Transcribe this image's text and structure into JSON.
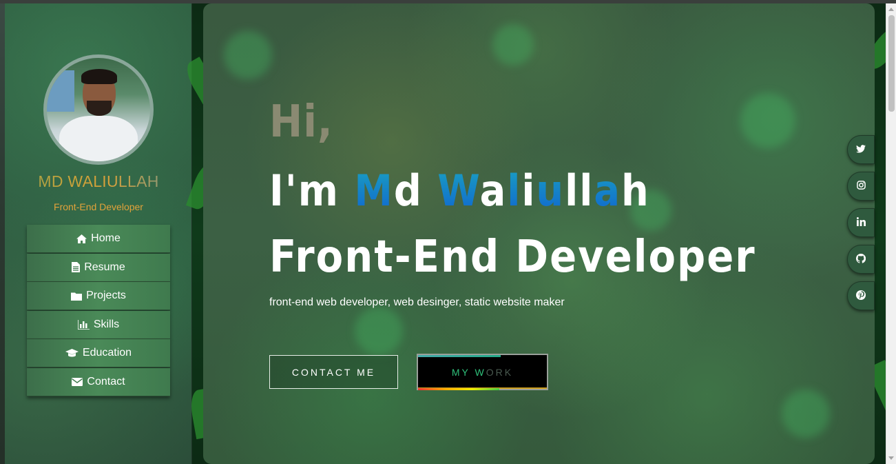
{
  "profile": {
    "name": "MD WALIULLAH",
    "role": "Front-End Developer"
  },
  "nav": {
    "items": [
      {
        "label": "Home",
        "icon": "home-icon"
      },
      {
        "label": "Resume",
        "icon": "file-icon"
      },
      {
        "label": "Projects",
        "icon": "folder-icon"
      },
      {
        "label": "Skills",
        "icon": "bar-chart-icon"
      },
      {
        "label": "Education",
        "icon": "graduation-cap-icon"
      },
      {
        "label": "Contact",
        "icon": "envelope-icon"
      }
    ]
  },
  "hero": {
    "greeting": "Hi,",
    "intro_prefix": "I'm ",
    "name_letters": [
      "M",
      "d",
      " ",
      "W",
      "a",
      "l",
      "i",
      "u",
      "l",
      "l",
      "a",
      "h"
    ],
    "title": "Front-End Developer",
    "tagline": "front-end web developer, web desinger, static website maker",
    "contact_button": "CONTACT ME",
    "work_button_a": "MY W",
    "work_button_b": "ORK"
  },
  "social": {
    "items": [
      "twitter-icon",
      "instagram-icon",
      "linkedin-icon",
      "github-icon",
      "pinterest-icon"
    ]
  },
  "colors": {
    "accent_gold": "#e2a23a",
    "accent_blue": "#1b8ee0",
    "work_text": "#2fc07a"
  }
}
